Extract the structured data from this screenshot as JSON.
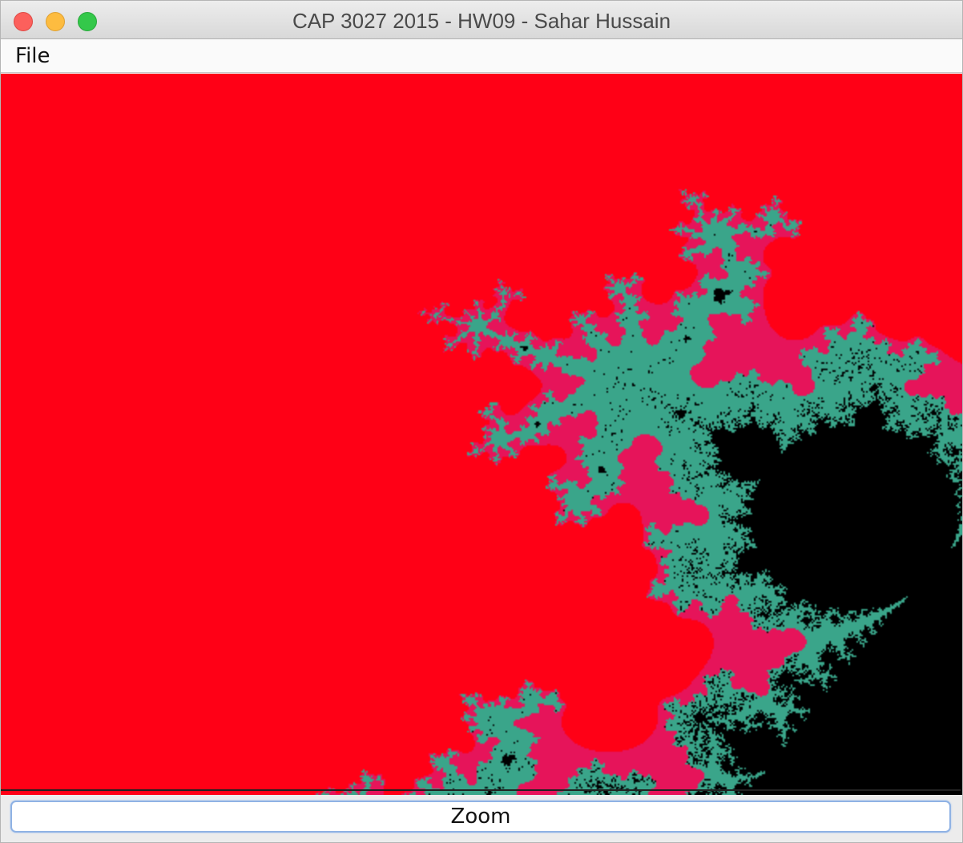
{
  "window": {
    "title": "CAP 3027 2015 - HW09 - Sahar Hussain"
  },
  "menubar": {
    "file_label": "File"
  },
  "canvas": {
    "fractal_type": "mandelbrot",
    "inside_color": "#000000",
    "outside_color": "#ff0016",
    "edge_color": "#3aa58a"
  },
  "actions": {
    "zoom_label": "Zoom"
  }
}
